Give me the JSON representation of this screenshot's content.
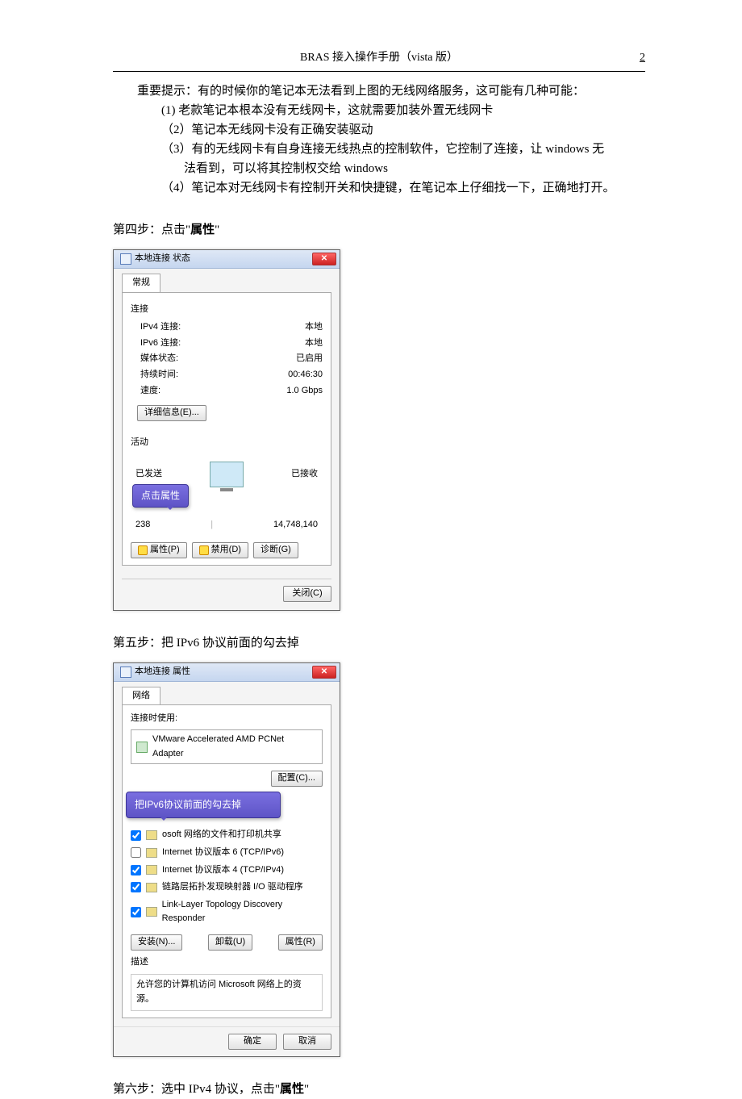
{
  "header": {
    "title": "BRAS 接入操作手册（vista 版）",
    "page": "2"
  },
  "tip": {
    "lead": "重要提示：有的时候你的笔记本无法看到上图的无线网络服务，这可能有几种可能：",
    "i1": "(1) 老款笔记本根本没有无线网卡，这就需要加装外置无线网卡",
    "i2": "（2）笔记本无线网卡没有正确安装驱动",
    "i3a": "（3）有的无线网卡有自身连接无线热点的控制软件，它控制了连接，让 windows 无",
    "i3b": "法看到，可以将其控制权交给 windows",
    "i4": "（4）笔记本对无线网卡有控制开关和快捷键，在笔记本上仔细找一下，正确地打开。"
  },
  "step4": {
    "pre": "第四步：点击",
    "q1": "\"",
    "bold": "属性",
    "q2": "\""
  },
  "step5": "第五步：把 IPv6 协议前面的勾去掉",
  "step6": {
    "pre": "第六步：选中 IPv4 协议，点击",
    "q1": "\"",
    "bold": "属性",
    "q2": "\""
  },
  "dlg1": {
    "title": "本地连接 状态",
    "tab": "常规",
    "group_conn": "连接",
    "rows": {
      "r1k": "IPv4 连接:",
      "r1v": "本地",
      "r2k": "IPv6 连接:",
      "r2v": "本地",
      "r3k": "媒体状态:",
      "r3v": "已启用",
      "r4k": "持续时间:",
      "r4v": "00:46:30",
      "r5k": "速度:",
      "r5v": "1.0 Gbps"
    },
    "btn_details": "详细信息(E)...",
    "group_act": "活动",
    "sent": "已发送",
    "dash": "——",
    "recv": "已接收",
    "callout": "点击属性",
    "bytes_sent": "238",
    "bytes_recv": "14,748,140",
    "btn_prop": "属性(P)",
    "btn_disable": "禁用(D)",
    "btn_diag": "诊断(G)",
    "btn_close": "关闭(C)"
  },
  "dlg2": {
    "title": "本地连接 属性",
    "tab": "网络",
    "use_label": "连接时使用:",
    "adapter": "VMware Accelerated AMD PCNet Adapter",
    "btn_cfg": "配置(C)...",
    "callout": "把IPv6协议前面的勾去掉",
    "items": {
      "c1": "osoft 网络的文件和打印机共享",
      "c2": "Internet 协议版本 6 (TCP/IPv6)",
      "c3": "Internet 协议版本 4 (TCP/IPv4)",
      "c4": "链路层拓扑发现映射器 I/O 驱动程序",
      "c5": "Link-Layer Topology Discovery Responder"
    },
    "btn_install": "安装(N)...",
    "btn_uninstall": "卸载(U)",
    "btn_prop": "属性(R)",
    "desc_label": "描述",
    "desc_text": "允许您的计算机访问 Microsoft 网络上的资源。",
    "btn_ok": "确定",
    "btn_cancel": "取消"
  }
}
